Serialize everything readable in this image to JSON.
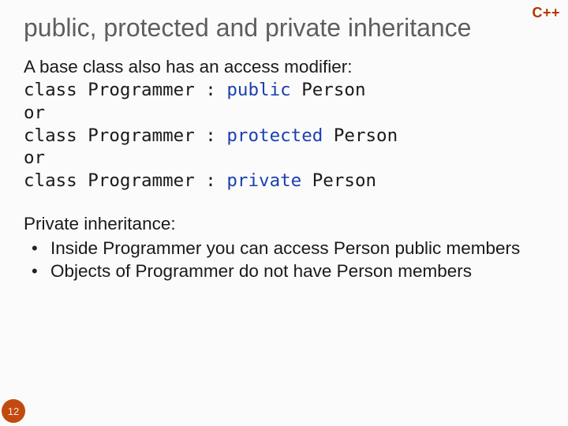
{
  "badge": "C++",
  "title": "public, protected and private inheritance",
  "intro": "A base class also has an access modifier:",
  "code": {
    "l1_pre": "class Programmer : ",
    "l1_kw": "public",
    "l1_post": " Person",
    "or1": "or",
    "l2_pre": "class Programmer : ",
    "l2_kw": "protected",
    "l2_post": " Person",
    "or2": "or",
    "l3_pre": "class Programmer : ",
    "l3_kw": "private",
    "l3_post": " Person"
  },
  "section2_heading": "Private inheritance:",
  "bullets": [
    "Inside Programmer you can access Person public members",
    "Objects of Programmer do not have Person members"
  ],
  "page_number": "12"
}
